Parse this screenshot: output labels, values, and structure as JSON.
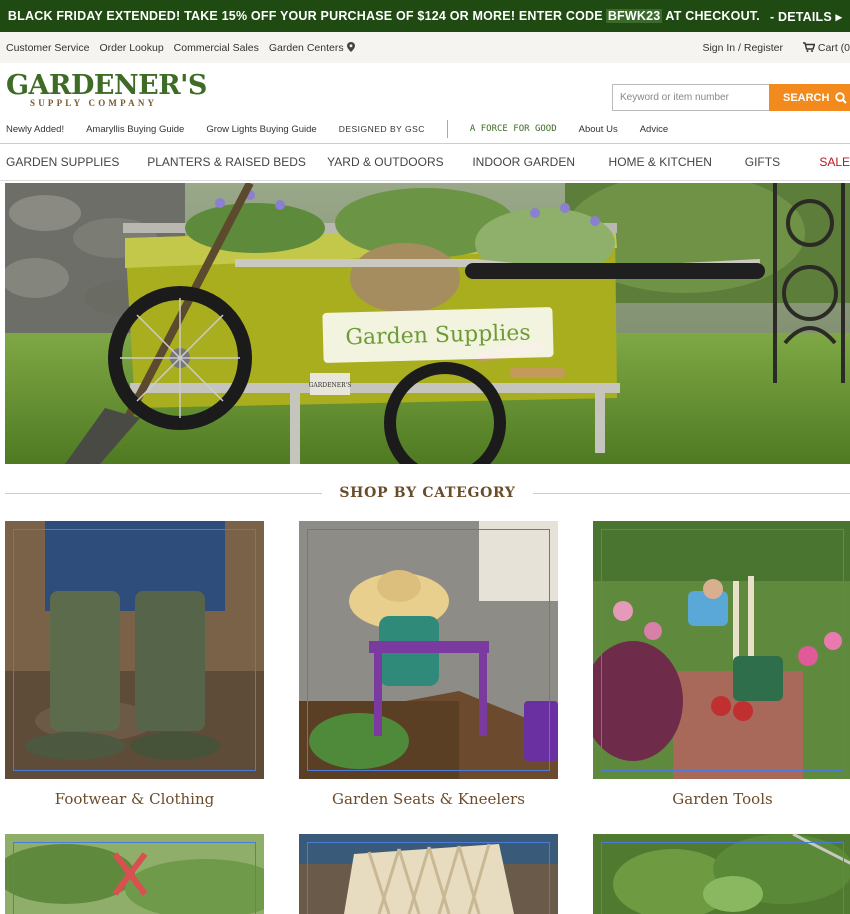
{
  "promo": {
    "text_before": "BLACK FRIDAY EXTENDED! TAKE 15% OFF YOUR PURCHASE OF $124 OR MORE! ENTER CODE",
    "code": "BFWK23",
    "text_after": "AT CHECKOUT.",
    "details": "- DETAILS ▸"
  },
  "utility_nav": {
    "customer_service": "Customer Service",
    "order_lookup": "Order Lookup",
    "commercial_sales": "Commercial Sales",
    "garden_centers": "Garden Centers",
    "sign_in": "Sign In / Register",
    "cart": "Cart (0"
  },
  "logo": {
    "main": "GARDENER'S",
    "sub": "SUPPLY COMPANY"
  },
  "search": {
    "placeholder": "Keyword or item number",
    "button": "SEARCH"
  },
  "secondary_nav": {
    "newly_added": "Newly Added!",
    "amaryllis": "Amaryllis Buying Guide",
    "grow_lights": "Grow Lights Buying Guide",
    "designed_by": "DESIGNED BY GSC",
    "force_for_good": "A FORCE FOR GOOD",
    "about_us": "About Us",
    "advice": "Advice"
  },
  "main_nav": [
    "GARDEN SUPPLIES",
    "PLANTERS & RAISED BEDS",
    "YARD & OUTDOORS",
    "INDOOR GARDEN",
    "HOME & KITCHEN",
    "GIFTS",
    "SALE"
  ],
  "hero": {
    "label": "Garden Supplies",
    "cart_brand": "GARDENER'S"
  },
  "shop_by_category": {
    "title": "SHOP BY CATEGORY",
    "categories": [
      "Footwear & Clothing",
      "Garden Seats & Kneelers",
      "Garden Tools"
    ]
  },
  "colors": {
    "promo_bg": "#1f4a12",
    "accent": "#f28a1e",
    "brand_green": "#3e6b26",
    "sale_red": "#c0141b"
  }
}
